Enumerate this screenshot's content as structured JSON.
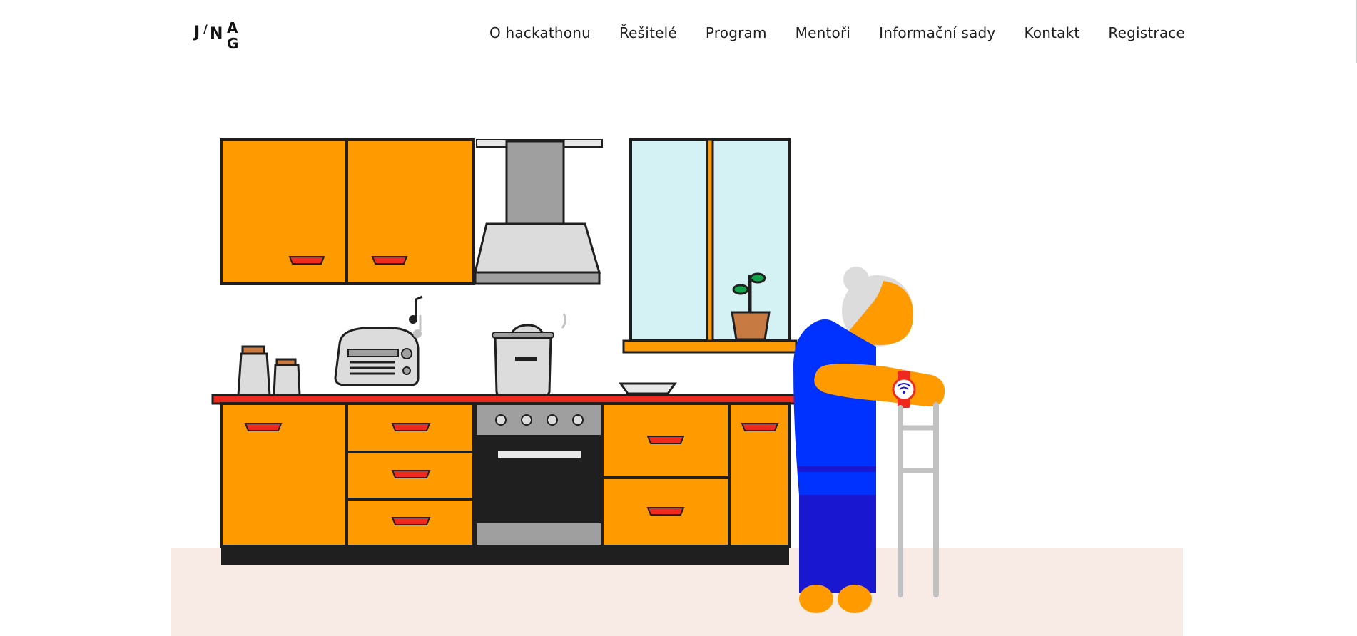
{
  "colors": {
    "accent_orange": "#ff9a00",
    "countertop_red": "#ee2a1e",
    "window_blue": "#d4f1f4",
    "oven_black": "#1f1f1f",
    "hood_gray": "#a0a0a0",
    "floor_tint": "#f8ebe5",
    "shirt_blue": "#0032ff",
    "pants_blue": "#1a17d1",
    "walker_gray": "#c2c2c2"
  },
  "header": {
    "logo_letters": [
      "J",
      "/",
      "N",
      "A",
      "G"
    ],
    "nav": [
      {
        "label": "O hackathonu"
      },
      {
        "label": "Řešitelé"
      },
      {
        "label": "Program"
      },
      {
        "label": "Mentoři"
      },
      {
        "label": "Informační sady"
      },
      {
        "label": "Kontakt"
      },
      {
        "label": "Registrace"
      }
    ]
  },
  "hero": {
    "illustration_icons": [
      "kitchen-cabinets-icon",
      "range-hood-icon",
      "window-icon",
      "potted-plant-icon",
      "canisters-icon",
      "radio-icon",
      "music-note-icon",
      "cooking-pot-icon",
      "plate-icon",
      "oven-icon",
      "elderly-woman-icon",
      "smartwatch-icon",
      "wifi-icon",
      "walker-icon"
    ]
  }
}
